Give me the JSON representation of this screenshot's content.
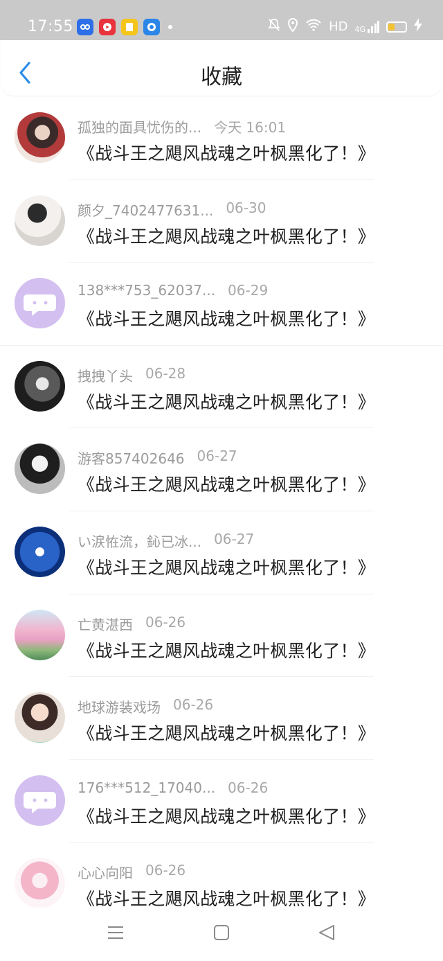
{
  "status_bar": {
    "time": "17:55",
    "network_label": "HD",
    "network_type": "4G",
    "battery_level": 0.35,
    "icons": [
      "infinity-app-icon",
      "video-app-icon",
      "book-app-icon",
      "camera-app-icon",
      "mute-icon",
      "location-icon",
      "wifi-icon",
      "signal-icon",
      "battery-icon",
      "charging-icon"
    ]
  },
  "header": {
    "title": "收藏",
    "back_icon": "chevron-left-icon"
  },
  "items": [
    {
      "name": "孤独的面具忧伤的...",
      "date": "今天 16:01",
      "title": "《战斗王之飓风战魂之叶枫黑化了！》"
    },
    {
      "name": "颜夕_7402477631...",
      "date": "06-30",
      "title": "《战斗王之飓风战魂之叶枫黑化了！》"
    },
    {
      "name": "138***753_62037...",
      "date": "06-29",
      "title": "《战斗王之飓风战魂之叶枫黑化了！》"
    },
    {
      "name": "拽拽丫头",
      "date": "06-28",
      "title": "《战斗王之飓风战魂之叶枫黑化了！》"
    },
    {
      "name": "游客857402646",
      "date": "06-27",
      "title": "《战斗王之飓风战魂之叶枫黑化了！》"
    },
    {
      "name": "い涙恠流，鈊已冰...",
      "date": "06-27",
      "title": "《战斗王之飓风战魂之叶枫黑化了！》"
    },
    {
      "name": "亡黄湛西",
      "date": "06-26",
      "title": "《战斗王之飓风战魂之叶枫黑化了！》"
    },
    {
      "name": "地球游装戏场",
      "date": "06-26",
      "title": "《战斗王之飓风战魂之叶枫黑化了！》"
    },
    {
      "name": "176***512_17040...",
      "date": "06-26",
      "title": "《战斗王之飓风战魂之叶枫黑化了！》"
    },
    {
      "name": "心心向阳",
      "date": "06-26",
      "title": "《战斗王之飓风战魂之叶枫黑化了！》"
    }
  ],
  "nav_bar": {
    "buttons": [
      "menu-icon",
      "home-icon",
      "back-triangle-icon"
    ]
  },
  "colors": {
    "status_bar_bg": "#c9c9c9",
    "accent": "#2a8ce8",
    "default_avatar": "#d3bff0"
  }
}
